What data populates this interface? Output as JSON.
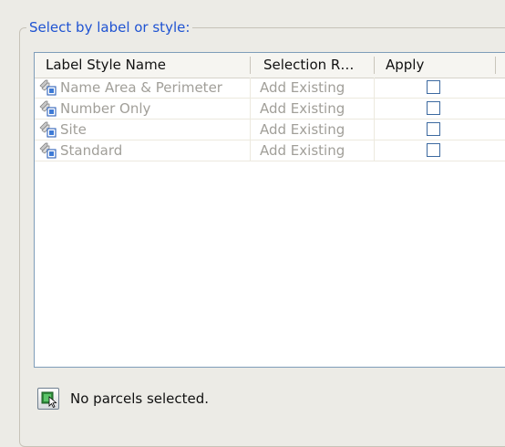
{
  "groupbox": {
    "title": "Select by label or style:"
  },
  "table": {
    "columns": [
      "Label Style Name",
      "Selection R…",
      "Apply"
    ],
    "rows": [
      {
        "name": "Name Area & Perimeter",
        "selection_rule": "Add Existing",
        "apply": false,
        "icon": "label-style-icon"
      },
      {
        "name": "Number Only",
        "selection_rule": "Add Existing",
        "apply": false,
        "icon": "label-style-icon"
      },
      {
        "name": "Site",
        "selection_rule": "Add Existing",
        "apply": false,
        "icon": "label-style-icon"
      },
      {
        "name": "Standard",
        "selection_rule": "Add Existing",
        "apply": false,
        "icon": "label-style-icon"
      }
    ]
  },
  "status": {
    "button_icon": "select-parcels-icon",
    "text": "No parcels selected."
  },
  "colors": {
    "group_title": "#1f53d2",
    "disabled_text": "#a19f99",
    "checkbox_border": "#3d6aa0"
  }
}
